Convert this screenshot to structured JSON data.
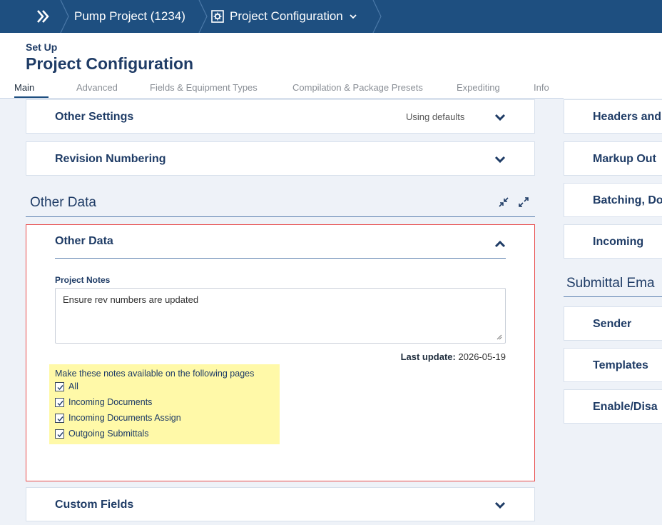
{
  "breadcrumb": {
    "home_icon": "double-chevron-right-icon",
    "project": "Pump Project (1234)",
    "config_icon": "gear-box-icon",
    "current": "Project Configuration"
  },
  "header": {
    "subtitle": "Set Up",
    "title": "Project Configuration",
    "tabs": [
      {
        "label": "Main",
        "active": true
      },
      {
        "label": "Advanced"
      },
      {
        "label": "Fields & Equipment Types"
      },
      {
        "label": "Compilation & Package Presets"
      },
      {
        "label": "Expediting"
      },
      {
        "label": "Info"
      }
    ]
  },
  "left": {
    "other_settings": {
      "title": "Other Settings",
      "status": "Using defaults"
    },
    "revision_numbering": {
      "title": "Revision Numbering"
    },
    "section_title": "Other Data",
    "other_data": {
      "title": "Other Data",
      "notes_label": "Project Notes",
      "notes_value": "Ensure rev numbers are updated",
      "last_update_label": "Last update:",
      "last_update_value": "2026-05-19",
      "availability_label": "Make these notes available on the following pages",
      "options": [
        {
          "label": "All",
          "checked": true
        },
        {
          "label": "Incoming Documents",
          "checked": true
        },
        {
          "label": "Incoming Documents Assign",
          "checked": true
        },
        {
          "label": "Outgoing Submittals",
          "checked": true
        }
      ]
    },
    "custom_fields": {
      "title": "Custom Fields"
    }
  },
  "right": {
    "panels": [
      {
        "title": "Headers and"
      },
      {
        "title": "Markup Out"
      },
      {
        "title": "Batching, Do"
      },
      {
        "title": "Incoming"
      }
    ],
    "section_title": "Submittal Ema",
    "email_panels": [
      {
        "title": "Sender"
      },
      {
        "title": "Templates"
      },
      {
        "title": "Enable/Disa"
      }
    ]
  },
  "colors": {
    "accent": "#1e4f80",
    "highlight": "#fff9a8",
    "focus_border": "#e84a4a"
  }
}
